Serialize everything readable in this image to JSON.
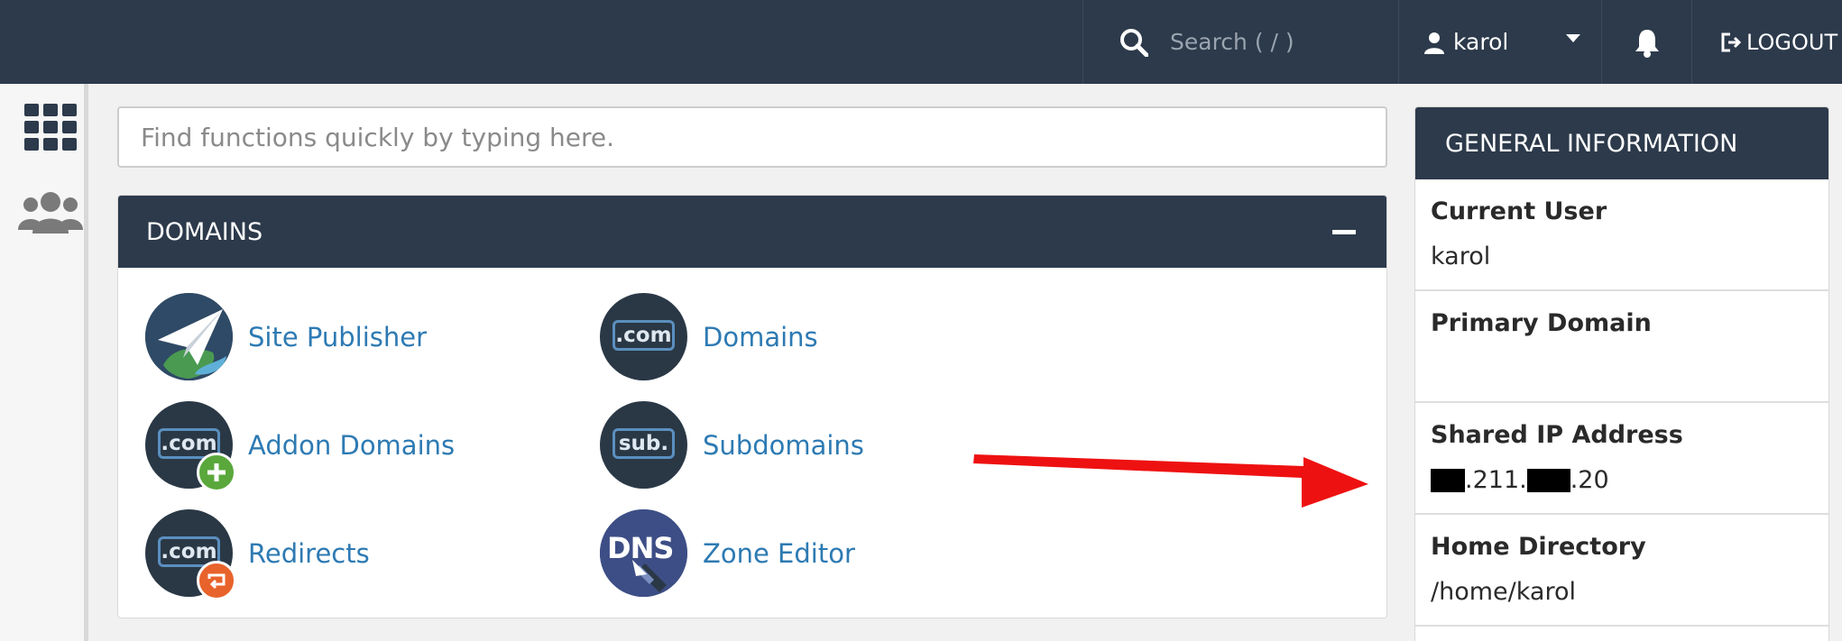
{
  "header": {
    "search_placeholder": "Search ( / )",
    "username": "karol",
    "logout_label": "LOGOUT"
  },
  "quickfind": {
    "placeholder": "Find functions quickly by typing here."
  },
  "domains_panel": {
    "title": "DOMAINS",
    "items": [
      {
        "label": "Site Publisher",
        "icon": "paper-plane-globe-icon"
      },
      {
        "label": "Domains",
        "icon": "dotcom-icon",
        "badge": ".com"
      },
      {
        "label": "Addon Domains",
        "icon": "dotcom-plus-icon",
        "badge": ".com"
      },
      {
        "label": "Subdomains",
        "icon": "subdomain-icon",
        "badge": "sub."
      },
      {
        "label": "Redirects",
        "icon": "dotcom-redirect-icon",
        "badge": ".com"
      },
      {
        "label": "Zone Editor",
        "icon": "dns-icon",
        "badge": "DNS"
      }
    ]
  },
  "general_info": {
    "title": "GENERAL INFORMATION",
    "rows": [
      {
        "label": "Current User",
        "value": "karol"
      },
      {
        "label": "Primary Domain",
        "value": ""
      },
      {
        "label": "Shared IP Address",
        "value_parts": [
          ".211.",
          ".20"
        ]
      },
      {
        "label": "Home Directory",
        "value": "/home/karol"
      }
    ]
  },
  "colors": {
    "topbar": "#2c3a4b",
    "link": "#2d7ab3",
    "annotation_arrow": "#ee1111"
  }
}
